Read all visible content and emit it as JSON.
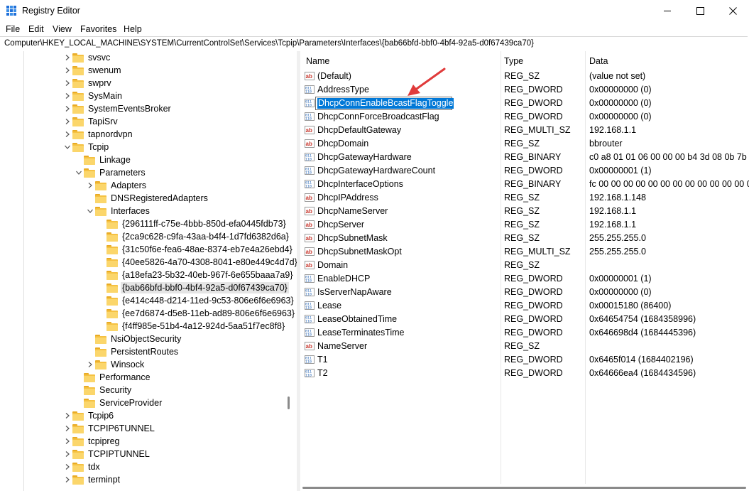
{
  "window": {
    "title": "Registry Editor"
  },
  "menu": [
    "File",
    "Edit",
    "View",
    "Favorites",
    "Help"
  ],
  "address": "Computer\\HKEY_LOCAL_MACHINE\\SYSTEM\\CurrentControlSet\\Services\\Tcpip\\Parameters\\Interfaces\\{bab66bfd-bbf0-4bf4-92a5-d0f67439ca70}",
  "tree": [
    {
      "label": "svsvc",
      "twisty": "collapsed",
      "selected": false
    },
    {
      "label": "swenum",
      "twisty": "collapsed",
      "selected": false
    },
    {
      "label": "swprv",
      "twisty": "collapsed",
      "selected": false
    },
    {
      "label": "SysMain",
      "twisty": "collapsed",
      "selected": false
    },
    {
      "label": "SystemEventsBroker",
      "twisty": "collapsed",
      "selected": false
    },
    {
      "label": "TapiSrv",
      "twisty": "collapsed",
      "selected": false
    },
    {
      "label": "tapnordvpn",
      "twisty": "collapsed",
      "selected": false
    },
    {
      "label": "Tcpip",
      "twisty": "expanded",
      "selected": false
    },
    {
      "label": "Linkage",
      "twisty": "none",
      "selected": false
    },
    {
      "label": "Parameters",
      "twisty": "expanded",
      "selected": false
    },
    {
      "label": "Adapters",
      "twisty": "collapsed",
      "selected": false
    },
    {
      "label": "DNSRegisteredAdapters",
      "twisty": "none",
      "selected": false
    },
    {
      "label": "Interfaces",
      "twisty": "expanded",
      "selected": false
    },
    {
      "label": "{296111ff-c75e-4bbb-850d-efa0445fdb73}",
      "twisty": "none",
      "selected": false
    },
    {
      "label": "{2ca9c628-c9fa-43aa-b4f4-1d7fd6382d6a}",
      "twisty": "none",
      "selected": false
    },
    {
      "label": "{31c50f6e-fea6-48ae-8374-eb7e4a26ebd4}",
      "twisty": "none",
      "selected": false
    },
    {
      "label": "{40ee5826-4a70-4308-8041-e80e449c4d7d}",
      "twisty": "none",
      "selected": false
    },
    {
      "label": "{a18efa23-5b32-40eb-967f-6e655baaa7a9}",
      "twisty": "none",
      "selected": false
    },
    {
      "label": "{bab66bfd-bbf0-4bf4-92a5-d0f67439ca70}",
      "twisty": "none",
      "selected": true
    },
    {
      "label": "{e414c448-d214-11ed-9c53-806e6f6e6963}",
      "twisty": "none",
      "selected": false
    },
    {
      "label": "{ee7d6874-d5e8-11eb-ad89-806e6f6e6963}",
      "twisty": "none",
      "selected": false
    },
    {
      "label": "{f4ff985e-51b4-4a12-924d-5aa51f7ec8f8}",
      "twisty": "none",
      "selected": false
    },
    {
      "label": "NsiObjectSecurity",
      "twisty": "none",
      "selected": false
    },
    {
      "label": "PersistentRoutes",
      "twisty": "none",
      "selected": false
    },
    {
      "label": "Winsock",
      "twisty": "collapsed",
      "selected": false
    },
    {
      "label": "Performance",
      "twisty": "none",
      "selected": false
    },
    {
      "label": "Security",
      "twisty": "none",
      "selected": false
    },
    {
      "label": "ServiceProvider",
      "twisty": "none",
      "selected": false
    },
    {
      "label": "Tcpip6",
      "twisty": "collapsed",
      "selected": false
    },
    {
      "label": "TCPIP6TUNNEL",
      "twisty": "collapsed",
      "selected": false
    },
    {
      "label": "tcpipreg",
      "twisty": "collapsed",
      "selected": false
    },
    {
      "label": "TCPIPTUNNEL",
      "twisty": "collapsed",
      "selected": false
    },
    {
      "label": "tdx",
      "twisty": "collapsed",
      "selected": false
    },
    {
      "label": "terminpt",
      "twisty": "collapsed",
      "selected": false
    }
  ],
  "columns": {
    "name": "Name",
    "type": "Type",
    "data": "Data"
  },
  "values": [
    {
      "icon": "string-value-icon",
      "name": "(Default)",
      "type": "REG_SZ",
      "data": "(value not set)"
    },
    {
      "icon": "binary-value-icon",
      "name": "AddressType",
      "type": "REG_DWORD",
      "data": "0x00000000 (0)"
    },
    {
      "icon": "binary-value-icon",
      "name": "DhcpConnEnableBcastFlagToggle",
      "type": "REG_DWORD",
      "data": "0x00000000 (0)",
      "editing": true
    },
    {
      "icon": "binary-value-icon",
      "name": "DhcpConnForceBroadcastFlag",
      "type": "REG_DWORD",
      "data": "0x00000000 (0)"
    },
    {
      "icon": "string-value-icon",
      "name": "DhcpDefaultGateway",
      "type": "REG_MULTI_SZ",
      "data": "192.168.1.1"
    },
    {
      "icon": "string-value-icon",
      "name": "DhcpDomain",
      "type": "REG_SZ",
      "data": "bbrouter"
    },
    {
      "icon": "binary-value-icon",
      "name": "DhcpGatewayHardware",
      "type": "REG_BINARY",
      "data": "c0 a8 01 01 06 00 00 00 b4 3d 08 0b 7b f0"
    },
    {
      "icon": "binary-value-icon",
      "name": "DhcpGatewayHardwareCount",
      "type": "REG_DWORD",
      "data": "0x00000001 (1)"
    },
    {
      "icon": "binary-value-icon",
      "name": "DhcpInterfaceOptions",
      "type": "REG_BINARY",
      "data": "fc 00 00 00 00 00 00 00 00 00 00 00 00 00 00 00 00 0"
    },
    {
      "icon": "string-value-icon",
      "name": "DhcpIPAddress",
      "type": "REG_SZ",
      "data": "192.168.1.148"
    },
    {
      "icon": "string-value-icon",
      "name": "DhcpNameServer",
      "type": "REG_SZ",
      "data": "192.168.1.1"
    },
    {
      "icon": "string-value-icon",
      "name": "DhcpServer",
      "type": "REG_SZ",
      "data": "192.168.1.1"
    },
    {
      "icon": "string-value-icon",
      "name": "DhcpSubnetMask",
      "type": "REG_SZ",
      "data": "255.255.255.0"
    },
    {
      "icon": "string-value-icon",
      "name": "DhcpSubnetMaskOpt",
      "type": "REG_MULTI_SZ",
      "data": "255.255.255.0"
    },
    {
      "icon": "string-value-icon",
      "name": "Domain",
      "type": "REG_SZ",
      "data": ""
    },
    {
      "icon": "binary-value-icon",
      "name": "EnableDHCP",
      "type": "REG_DWORD",
      "data": "0x00000001 (1)"
    },
    {
      "icon": "binary-value-icon",
      "name": "IsServerNapAware",
      "type": "REG_DWORD",
      "data": "0x00000000 (0)"
    },
    {
      "icon": "binary-value-icon",
      "name": "Lease",
      "type": "REG_DWORD",
      "data": "0x00015180 (86400)"
    },
    {
      "icon": "binary-value-icon",
      "name": "LeaseObtainedTime",
      "type": "REG_DWORD",
      "data": "0x64654754 (1684358996)"
    },
    {
      "icon": "binary-value-icon",
      "name": "LeaseTerminatesTime",
      "type": "REG_DWORD",
      "data": "0x646698d4 (1684445396)"
    },
    {
      "icon": "string-value-icon",
      "name": "NameServer",
      "type": "REG_SZ",
      "data": ""
    },
    {
      "icon": "binary-value-icon",
      "name": "T1",
      "type": "REG_DWORD",
      "data": "0x6465f014 (1684402196)"
    },
    {
      "icon": "binary-value-icon",
      "name": "T2",
      "type": "REG_DWORD",
      "data": "0x64666ea4 (1684434596)"
    }
  ],
  "colors": {
    "selection": "#0078d7",
    "arrow": "#e03a3a",
    "folder": "#f5c142"
  }
}
